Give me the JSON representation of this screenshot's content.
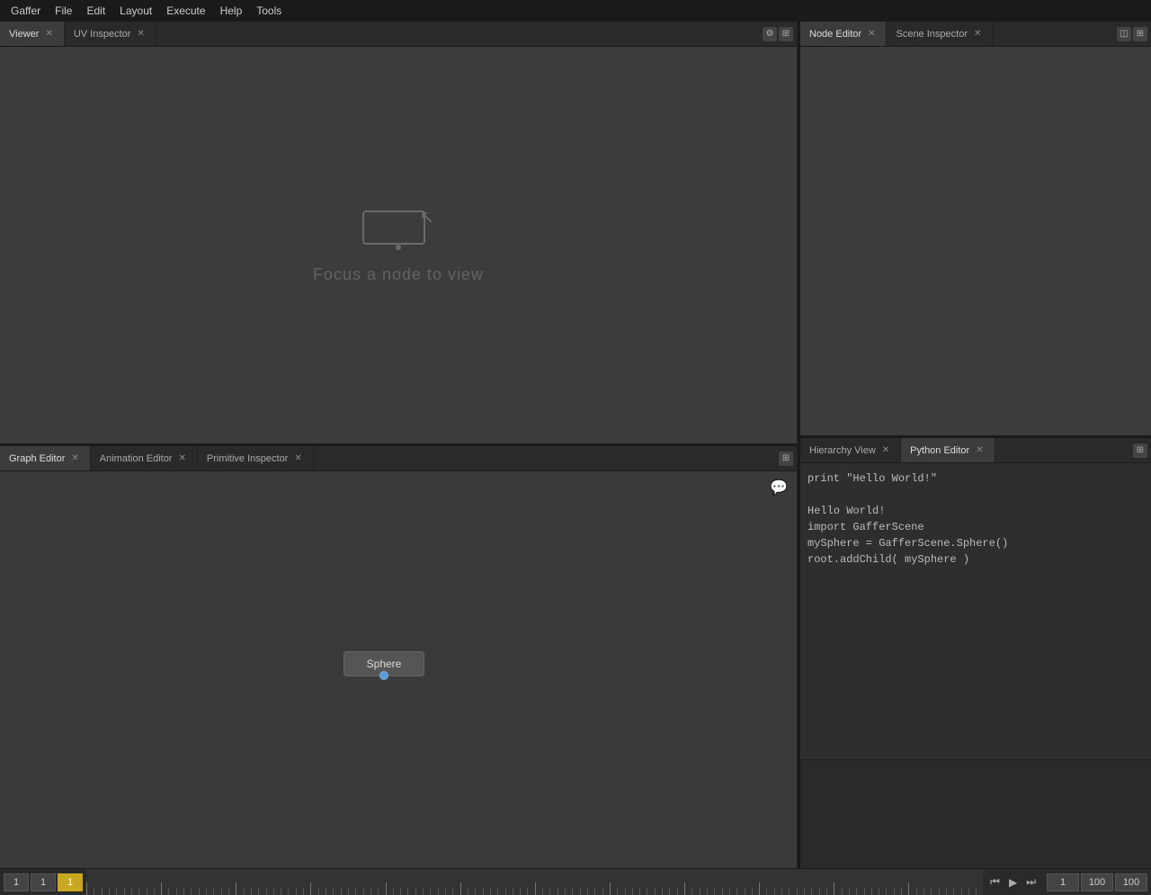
{
  "menubar": {
    "items": [
      "Gaffer",
      "File",
      "Edit",
      "Layout",
      "Execute",
      "Help",
      "Tools"
    ]
  },
  "viewer_tab": {
    "tabs": [
      {
        "label": "Viewer",
        "active": true
      },
      {
        "label": "UV Inspector",
        "active": false
      }
    ],
    "placeholder_text": "Focus a node to view"
  },
  "bottom_left_tabs": {
    "tabs": [
      {
        "label": "Graph Editor",
        "active": true
      },
      {
        "label": "Animation Editor",
        "active": false
      },
      {
        "label": "Primitive Inspector",
        "active": false
      }
    ]
  },
  "right_top_tabs": {
    "tabs": [
      {
        "label": "Node Editor",
        "active": true
      },
      {
        "label": "Scene Inspector",
        "active": false
      }
    ]
  },
  "right_bottom_tabs": {
    "tabs": [
      {
        "label": "Hierarchy View",
        "active": false
      },
      {
        "label": "Python Editor",
        "active": true
      }
    ]
  },
  "graph": {
    "node_label": "Sphere"
  },
  "python": {
    "code": [
      "print \"Hello World!\"",
      "",
      "Hello World!",
      "import GafferScene",
      "mySphere = GafferScene.Sphere()",
      "root.addChild( mySphere )"
    ]
  },
  "timeline": {
    "start": "1",
    "current": "1",
    "highlight": "1",
    "end": "100",
    "out": "100"
  }
}
